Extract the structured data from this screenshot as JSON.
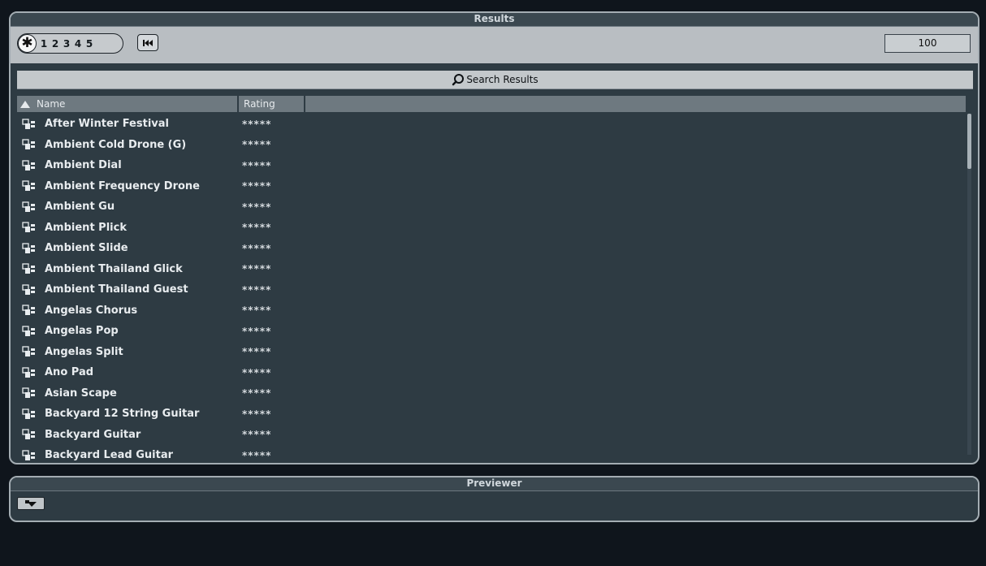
{
  "results": {
    "title": "Results",
    "rating_filter": {
      "all_symbol": "✱",
      "levels": [
        "1",
        "2",
        "3",
        "4",
        "5"
      ]
    },
    "count": "100",
    "search_label": "Search Results",
    "columns": {
      "name": "Name",
      "rating": "Rating"
    },
    "items": [
      {
        "name": "After Winter Festival",
        "rating": "*****"
      },
      {
        "name": "Ambient Cold Drone (G)",
        "rating": "*****"
      },
      {
        "name": "Ambient Dial",
        "rating": "*****"
      },
      {
        "name": "Ambient Frequency Drone",
        "rating": "*****"
      },
      {
        "name": "Ambient Gu",
        "rating": "*****"
      },
      {
        "name": "Ambient Plick",
        "rating": "*****"
      },
      {
        "name": "Ambient Slide",
        "rating": "*****"
      },
      {
        "name": "Ambient Thailand Glick",
        "rating": "*****"
      },
      {
        "name": "Ambient Thailand Guest",
        "rating": "*****"
      },
      {
        "name": "Angelas Chorus",
        "rating": "*****"
      },
      {
        "name": "Angelas Pop",
        "rating": "*****"
      },
      {
        "name": "Angelas Split",
        "rating": "*****"
      },
      {
        "name": "Ano Pad",
        "rating": "*****"
      },
      {
        "name": "Asian Scape",
        "rating": "*****"
      },
      {
        "name": "Backyard 12 String Guitar",
        "rating": "*****"
      },
      {
        "name": "Backyard Guitar",
        "rating": "*****"
      },
      {
        "name": "Backyard Lead Guitar",
        "rating": "*****"
      }
    ]
  },
  "previewer": {
    "title": "Previewer"
  },
  "icons": {
    "rewind": "rewind-to-start-icon",
    "search": "magnifier-icon",
    "preset": "preset-icon",
    "sort": "sort-ascending-icon",
    "preview_mode": "preview-mode-icon"
  }
}
